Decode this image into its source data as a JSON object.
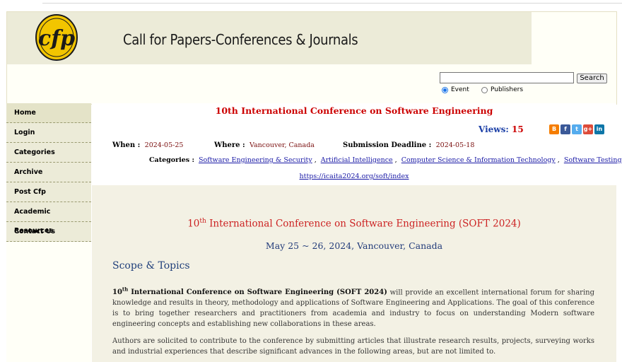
{
  "header": {
    "site_title": "Call for Papers-Conferences & Journals",
    "logo_text": "cfp",
    "search": {
      "value": "",
      "button_label": "Search",
      "options": [
        {
          "label": "Event",
          "checked": true
        },
        {
          "label": "Publishers",
          "checked": false
        }
      ]
    }
  },
  "sidebar": {
    "items": [
      "Home",
      "Login",
      "Categories",
      "Archive",
      "Post Cfp",
      "Academic Resources",
      "Contact Us"
    ]
  },
  "conference": {
    "title": "10th International Conference on Software Engineering",
    "views_label": "Views:",
    "views_count": "15",
    "when_label": "When :",
    "when": "2024-05-25",
    "where_label": "Where :",
    "where": "Vancouver, Canada",
    "deadline_label": "Submission Deadline :",
    "deadline": "2024-05-18",
    "categories_label": "Categories :",
    "categories": [
      "Software Engineering & Security",
      "Artificial Intelligence",
      "Computer Science & Information Technology",
      "Software Testing"
    ],
    "url": "https://icaita2024.org/soft/index"
  },
  "share_icons": [
    {
      "name": "blogger-icon",
      "glyph": "B",
      "color": "#f57d00"
    },
    {
      "name": "facebook-icon",
      "glyph": "f",
      "color": "#3b5998"
    },
    {
      "name": "twitter-icon",
      "glyph": "t",
      "color": "#55acee"
    },
    {
      "name": "googleplus-icon",
      "glyph": "g+",
      "color": "#dd4b39"
    },
    {
      "name": "linkedin-icon",
      "glyph": "in",
      "color": "#0e76a8"
    }
  ],
  "content": {
    "event_title_num": "10",
    "event_title_sup": "th",
    "event_title_rest": " International Conference on Software Engineering (SOFT 2024)",
    "event_date": "May 25 ~ 26, 2024, Vancouver, Canada",
    "scope_heading": "Scope & Topics",
    "para1_bold_num": "10",
    "para1_bold_sup": "th",
    "para1_bold_rest": " International Conference on Software Engineering (SOFT 2024)",
    "para1_text": " will provide an excellent international forum for sharing knowledge and results in theory, methodology and applications of Software Engineering and Applications. The goal of this conference is to bring together researchers and practitioners from academia and industry to focus on understanding Modern software engineering concepts and establishing new collaborations in these areas.",
    "para2_text": "Authors are solicited to contribute to the conference by submitting articles that illustrate research results, projects, surveying works and industrial experiences that describe significant advances in the following areas, but are not limited to."
  }
}
